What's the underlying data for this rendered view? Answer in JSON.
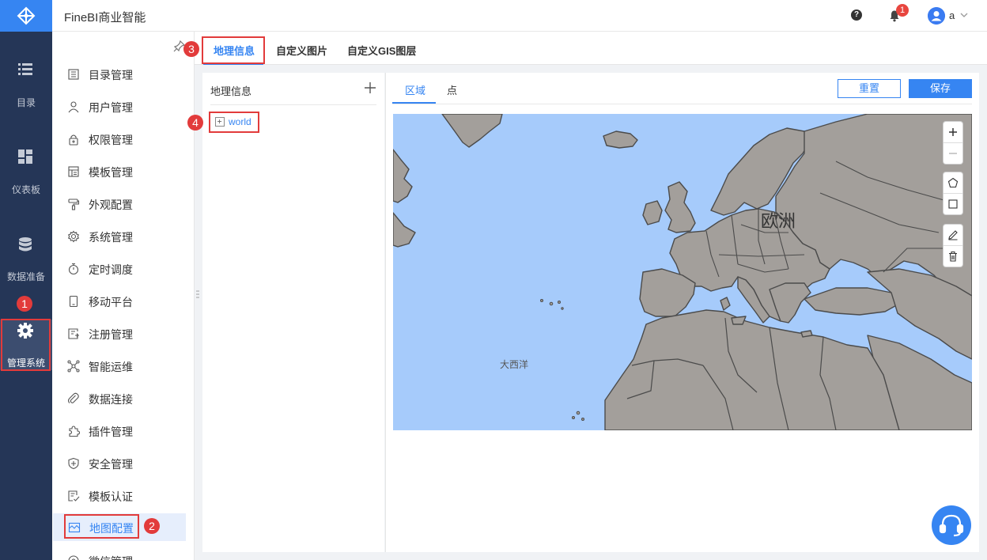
{
  "app": {
    "title": "FineBI商业智能"
  },
  "rail": {
    "items": [
      {
        "label": "目录",
        "icon": "list-icon"
      },
      {
        "label": "仪表板",
        "icon": "dashboard-icon"
      },
      {
        "label": "数据准备",
        "icon": "database-icon"
      },
      {
        "label": "管理系统",
        "icon": "gear-icon"
      }
    ]
  },
  "header": {
    "notification_count": "1",
    "user_name": "a"
  },
  "submenu": {
    "items": [
      {
        "label": "目录管理",
        "icon": "directory-icon"
      },
      {
        "label": "用户管理",
        "icon": "user-icon"
      },
      {
        "label": "权限管理",
        "icon": "lock-icon"
      },
      {
        "label": "模板管理",
        "icon": "template-icon"
      },
      {
        "label": "外观配置",
        "icon": "paint-roller-icon"
      },
      {
        "label": "系统管理",
        "icon": "settings-icon"
      },
      {
        "label": "定时调度",
        "icon": "timer-icon"
      },
      {
        "label": "移动平台",
        "icon": "mobile-icon"
      },
      {
        "label": "注册管理",
        "icon": "register-icon"
      },
      {
        "label": "智能运维",
        "icon": "network-icon"
      },
      {
        "label": "数据连接",
        "icon": "link-icon"
      },
      {
        "label": "插件管理",
        "icon": "puzzle-icon"
      },
      {
        "label": "安全管理",
        "icon": "shield-icon"
      },
      {
        "label": "模板认证",
        "icon": "certificate-icon"
      },
      {
        "label": "地图配置",
        "icon": "map-icon"
      },
      {
        "label": "微信管理",
        "icon": "wechat-icon"
      }
    ],
    "active": "地图配置"
  },
  "tabs": [
    {
      "label": "地理信息"
    },
    {
      "label": "自定义图片"
    },
    {
      "label": "自定义GIS图层"
    }
  ],
  "geo_panel": {
    "title": "地理信息",
    "tree": [
      {
        "label": "world"
      }
    ]
  },
  "region_panel": {
    "tabs": [
      {
        "label": "区域"
      },
      {
        "label": "点"
      }
    ],
    "reset_label": "重置",
    "save_label": "保存"
  },
  "map": {
    "labels": {
      "europe": "欧洲",
      "atlantic": "大西洋"
    },
    "controls": [
      "zoom-in",
      "zoom-out",
      "draw-polygon",
      "draw-rectangle",
      "edit",
      "delete"
    ]
  },
  "callouts": [
    "1",
    "2",
    "3",
    "4"
  ],
  "colors": {
    "accent": "#3685f2",
    "rail": "#253657",
    "ocean": "#a6cbfb",
    "land": "#a39f9b",
    "callout": "#e23b3b"
  }
}
